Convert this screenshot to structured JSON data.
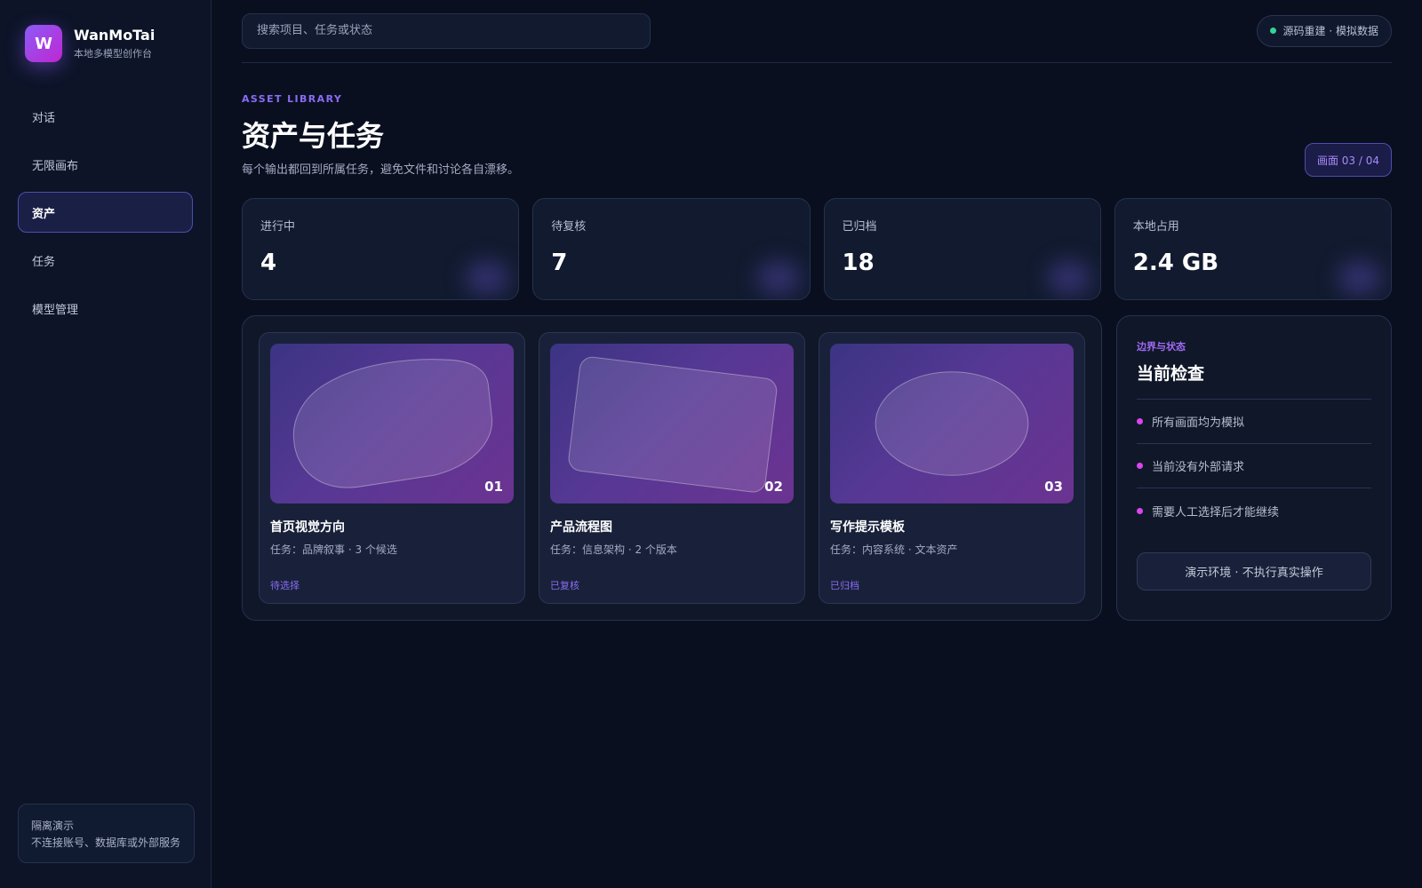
{
  "brand": {
    "logo_letter": "W",
    "name": "WanMoTai",
    "subtitle": "本地多模型创作台"
  },
  "nav": [
    {
      "label": "对话",
      "active": false
    },
    {
      "label": "无限画布",
      "active": false
    },
    {
      "label": "资产",
      "active": true
    },
    {
      "label": "任务",
      "active": false
    },
    {
      "label": "模型管理",
      "active": false
    }
  ],
  "side_note": {
    "line1": "隔离演示",
    "line2": "不连接账号、数据库或外部服务"
  },
  "search": {
    "placeholder": "搜索项目、任务或状态",
    "value": ""
  },
  "status": {
    "text": "源码重建 · 模拟数据",
    "color": "#34d399"
  },
  "header": {
    "eyebrow": "ASSET LIBRARY",
    "title": "资产与任务",
    "subtitle": "每个输出都回到所属任务，避免文件和讨论各自漂移。",
    "page_counter": "画面 03 / 04"
  },
  "stats": [
    {
      "label": "进行中",
      "value": "4"
    },
    {
      "label": "待复核",
      "value": "7"
    },
    {
      "label": "已归档",
      "value": "18"
    },
    {
      "label": "本地占用",
      "value": "2.4 GB"
    }
  ],
  "assets": [
    {
      "num": "01",
      "title": "首页视觉方向",
      "meta": "任务：品牌叙事 · 3 个候选",
      "tag": "待选择",
      "shape": "blob"
    },
    {
      "num": "02",
      "title": "产品流程图",
      "meta": "任务：信息架构 · 2 个版本",
      "tag": "已复核",
      "shape": "rect"
    },
    {
      "num": "03",
      "title": "写作提示模板",
      "meta": "任务：内容系统 · 文本资产",
      "tag": "已归档",
      "shape": "ellipse"
    }
  ],
  "check": {
    "eyebrow": "边界与状态",
    "title": "当前检查",
    "items": [
      "所有画面均为模拟",
      "当前没有外部请求",
      "需要人工选择后才能继续"
    ],
    "button": "演示环境 · 不执行真实操作"
  },
  "colors": {
    "accent": "#8b5cf6",
    "accent_pink": "#d946ef",
    "background": "#0a0f1f"
  }
}
